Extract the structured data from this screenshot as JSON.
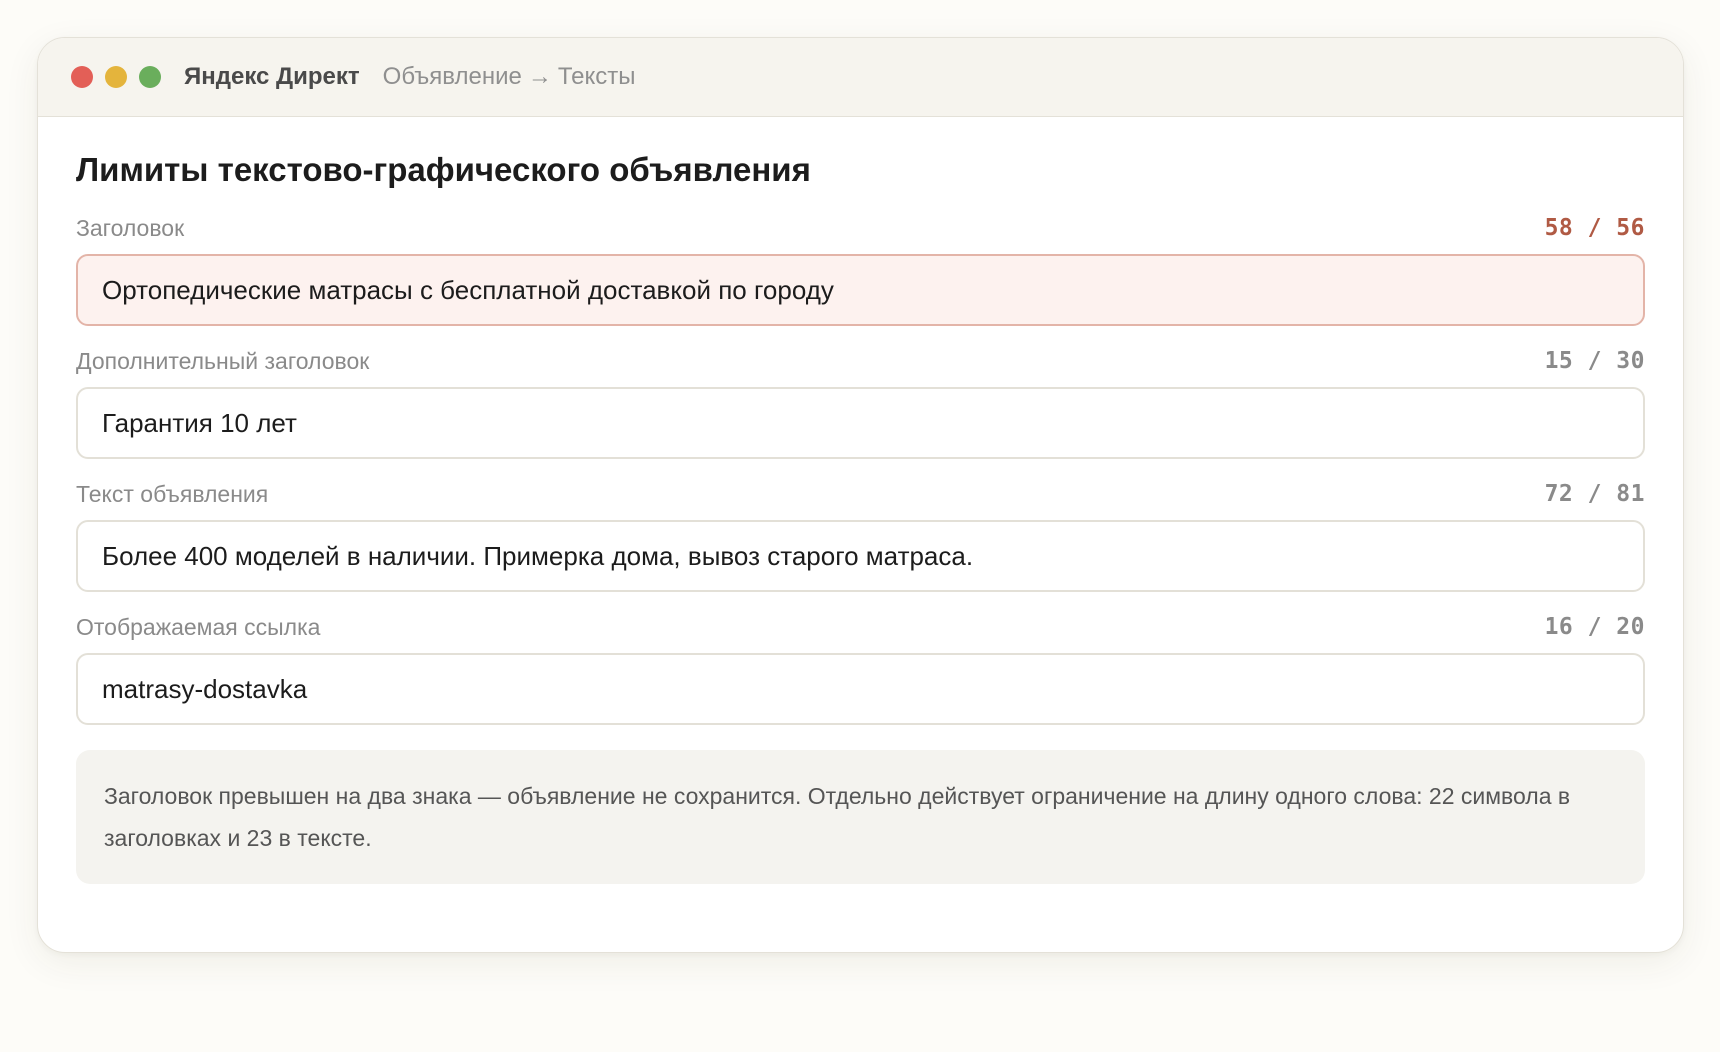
{
  "window": {
    "controls": [
      {
        "name": "close",
        "color": "#e35f57"
      },
      {
        "name": "minimize",
        "color": "#e4b43c"
      },
      {
        "name": "maximize",
        "color": "#6aae5c"
      }
    ],
    "app_title": "Яндекс Директ",
    "breadcrumb": {
      "parent": "Объявление",
      "separator": "→",
      "current": "Тексты"
    }
  },
  "page": {
    "title": "Лимиты текстово-графического объявления"
  },
  "fields": [
    {
      "label": "Заголовок",
      "counter": "58 / 56",
      "current": 58,
      "limit": 56,
      "value": "Ортопедические матрасы с бесплатной доставкой по городу",
      "over_limit": true
    },
    {
      "label": "Дополнительный заголовок",
      "counter": "15 / 30",
      "current": 15,
      "limit": 30,
      "value": "Гарантия 10 лет",
      "over_limit": false
    },
    {
      "label": "Текст объявления",
      "counter": "72 / 81",
      "current": 72,
      "limit": 81,
      "value": "Более 400 моделей в наличии. Примерка дома, вывоз старого матраса.",
      "over_limit": false
    },
    {
      "label": "Отображаемая ссылка",
      "counter": "16 / 20",
      "current": 16,
      "limit": 20,
      "value": "matrasy-dostavka",
      "over_limit": false
    }
  ],
  "note": {
    "text": "Заголовок превышен на два знака — объявление не сохранится. Отдельно действует ограничение на длину одного слова: 22 символа в заголовках и 23 в тексте."
  },
  "colors": {
    "error_counter": "#b05a44",
    "error_background": "#fdf2ef",
    "error_border": "#e3b4a8"
  }
}
